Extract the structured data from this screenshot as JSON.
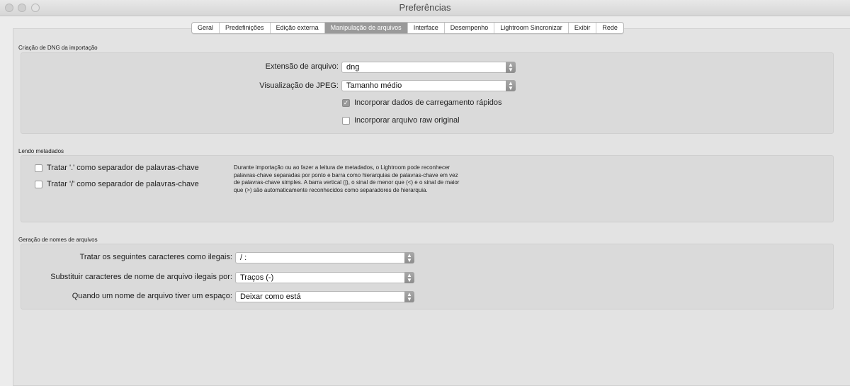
{
  "window": {
    "title": "Preferências"
  },
  "tabs": [
    {
      "label": "Geral"
    },
    {
      "label": "Predefinições"
    },
    {
      "label": "Edição externa"
    },
    {
      "label": "Manipulação de arquivos",
      "active": true
    },
    {
      "label": "Interface"
    },
    {
      "label": "Desempenho"
    },
    {
      "label": "Lightroom Sincronizar"
    },
    {
      "label": "Exibir"
    },
    {
      "label": "Rede"
    }
  ],
  "dng": {
    "section_label": "Criação de DNG da importação",
    "extension_label": "Extensão de arquivo:",
    "extension_value": "dng",
    "jpeg_label": "Visualização de JPEG:",
    "jpeg_value": "Tamanho médio",
    "fast_load_label": "Incorporar dados de carregamento rápidos",
    "fast_load_checked": true,
    "raw_label": "Incorporar arquivo raw original",
    "raw_checked": false
  },
  "metadata": {
    "section_label": "Lendo metadados",
    "dot_label": "Tratar '.' como separador de palavras-chave",
    "slash_label": "Tratar '/' como separador de palavras-chave",
    "description": "Durante importação ou ao fazer a leitura de metadados, o Lightroom pode reconhecer palavras-chave separadas por ponto e barra como hierarquias de palavras-chave em vez de palavras-chave simples. A barra vertical (|), o sinal de menor que (<) e o sinal de maior que (>) são automaticamente reconhecidos como separadores de hierarquia."
  },
  "filenames": {
    "section_label": "Geração de nomes de arquivos",
    "illegal_label": "Tratar os seguintes caracteres como ilegais:",
    "illegal_value": "/ :",
    "replace_label": "Substituir caracteres de nome de arquivo ilegais por:",
    "replace_value": "Traços (-)",
    "space_label": "Quando um nome de arquivo tiver um espaço:",
    "space_value": "Deixar como está"
  }
}
